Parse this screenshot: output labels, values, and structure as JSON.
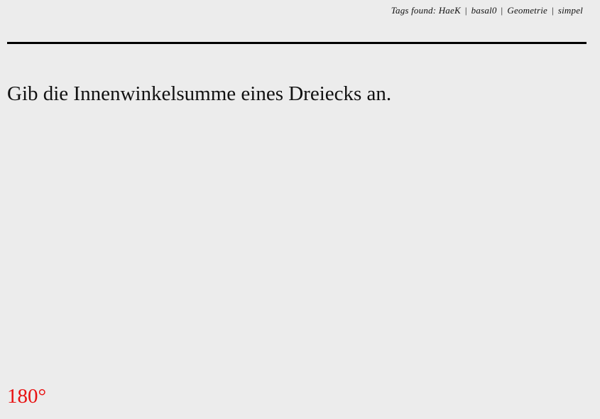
{
  "header": {
    "tags_label": "Tags found:",
    "tags": [
      "HaeK",
      "basal0",
      "Geometrie",
      "simpel"
    ],
    "separator": "|"
  },
  "question": {
    "text": "Gib die Innenwinkelsumme eines Dreiecks an."
  },
  "answer": {
    "text": "180°",
    "color": "#e81212"
  }
}
